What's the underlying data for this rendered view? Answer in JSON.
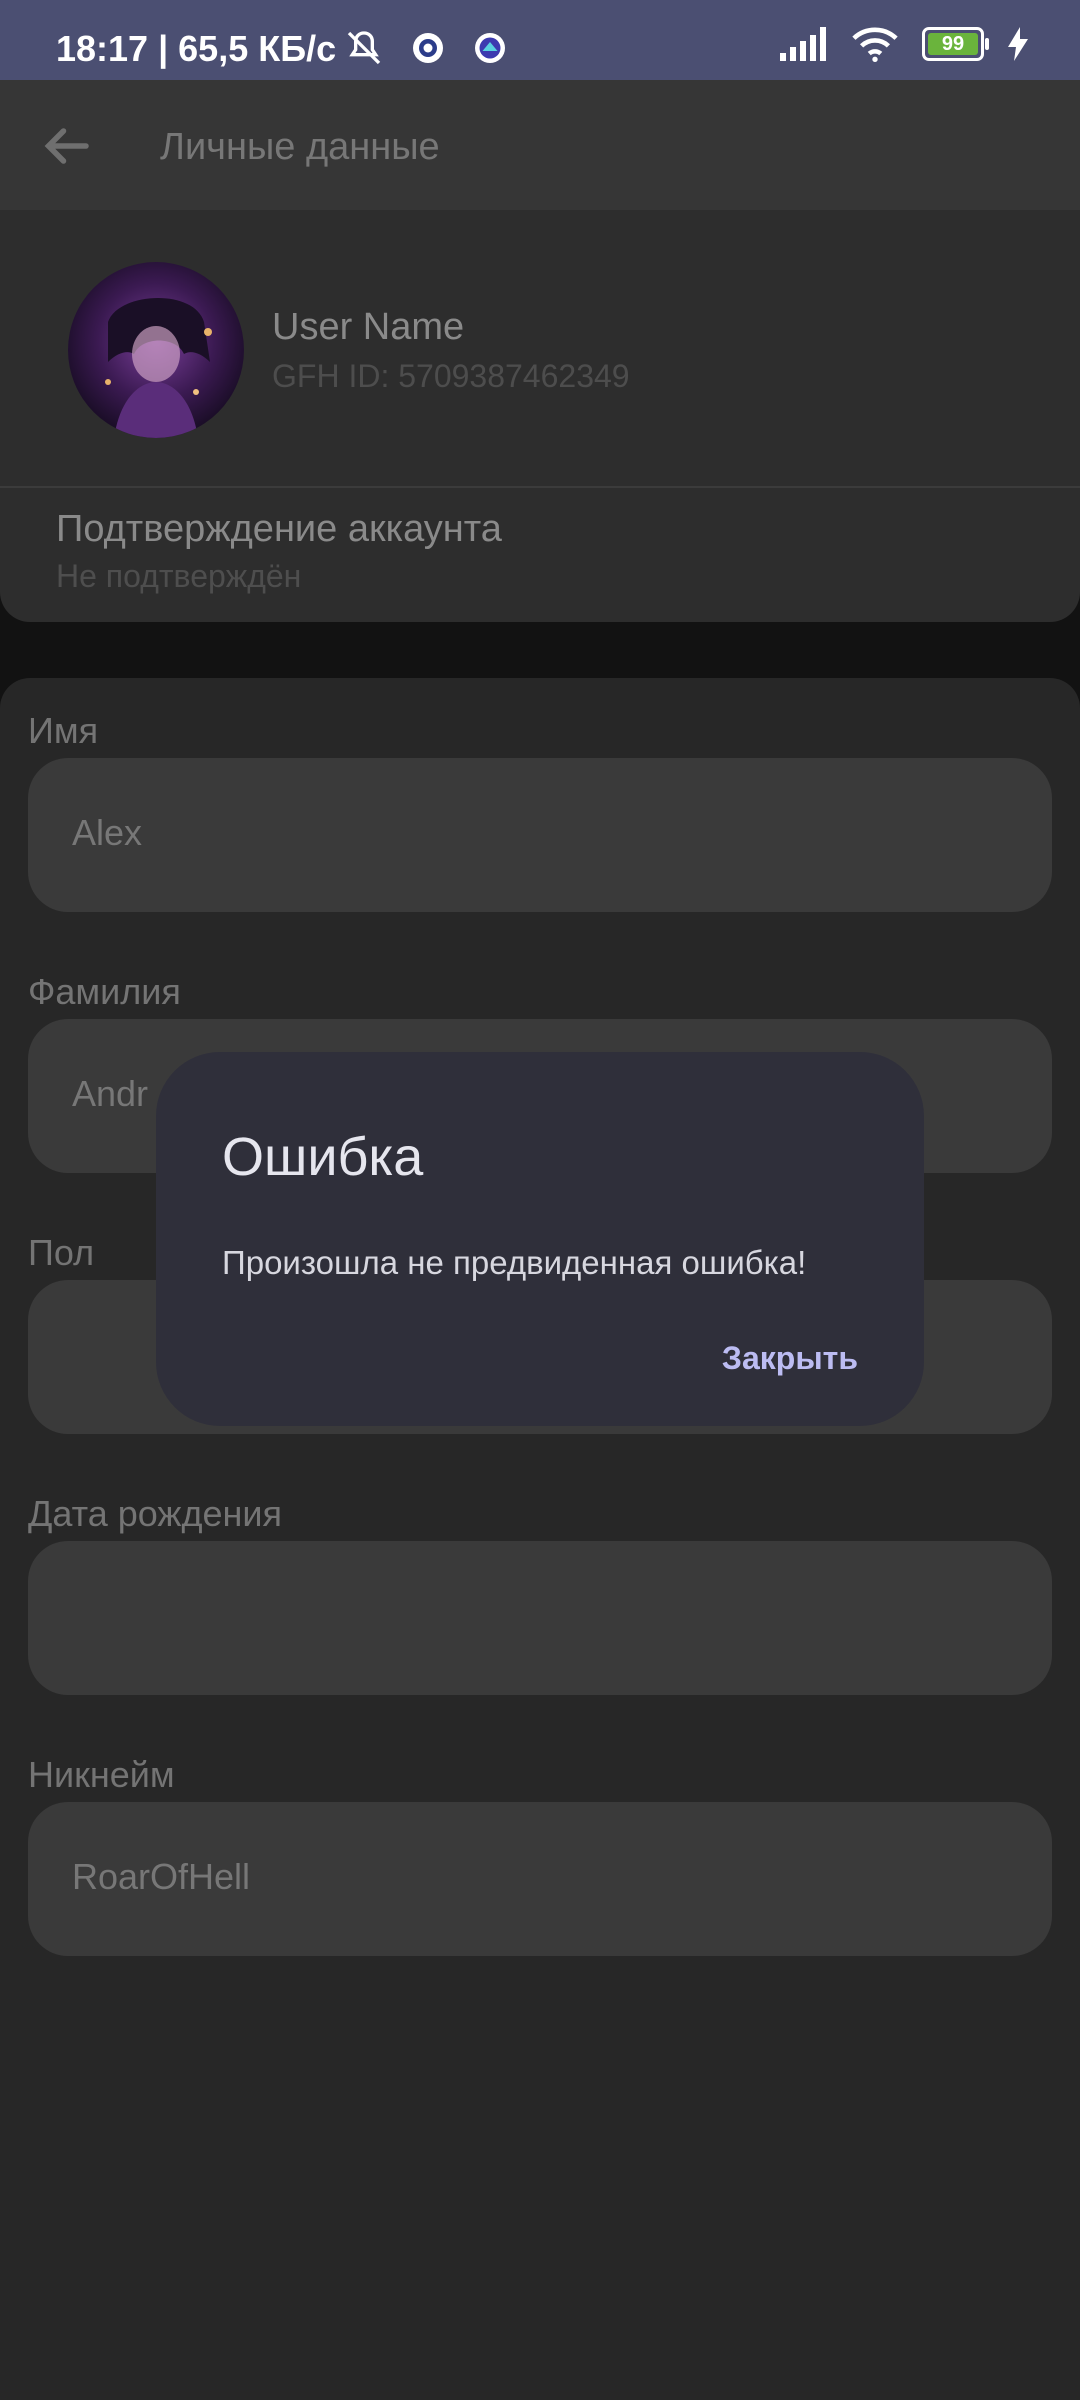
{
  "status_bar": {
    "time_speed": "18:17 | 65,5 КБ/с",
    "battery_level": "99",
    "icons": [
      "muted-bell-icon",
      "app-icon-1",
      "app-icon-2",
      "signal-icon",
      "wifi-icon",
      "battery-icon",
      "charging-icon"
    ],
    "battery_color": "#6ab43c"
  },
  "appbar": {
    "back_icon": "arrow-left-icon",
    "title": "Личные данные"
  },
  "profile": {
    "name": "User Name",
    "id": "GFH ID: 5709387462349",
    "verify_title": "Подтверждение аккаунта",
    "verify_status": "Не подтверждён"
  },
  "form": {
    "fields": [
      {
        "label": "Имя",
        "value": "Alex"
      },
      {
        "label": "Фамилия",
        "value": "Andr"
      },
      {
        "label": "Пол",
        "value": ""
      },
      {
        "label": "Дата рождения",
        "value": ""
      },
      {
        "label": "Никнейм",
        "value": "RoarOfHell"
      }
    ]
  },
  "dialog": {
    "title": "Ошибка",
    "message": "Произошла не предвиденная ошибка!",
    "close_label": "Закрыть",
    "accent": "#bcbcf2"
  }
}
